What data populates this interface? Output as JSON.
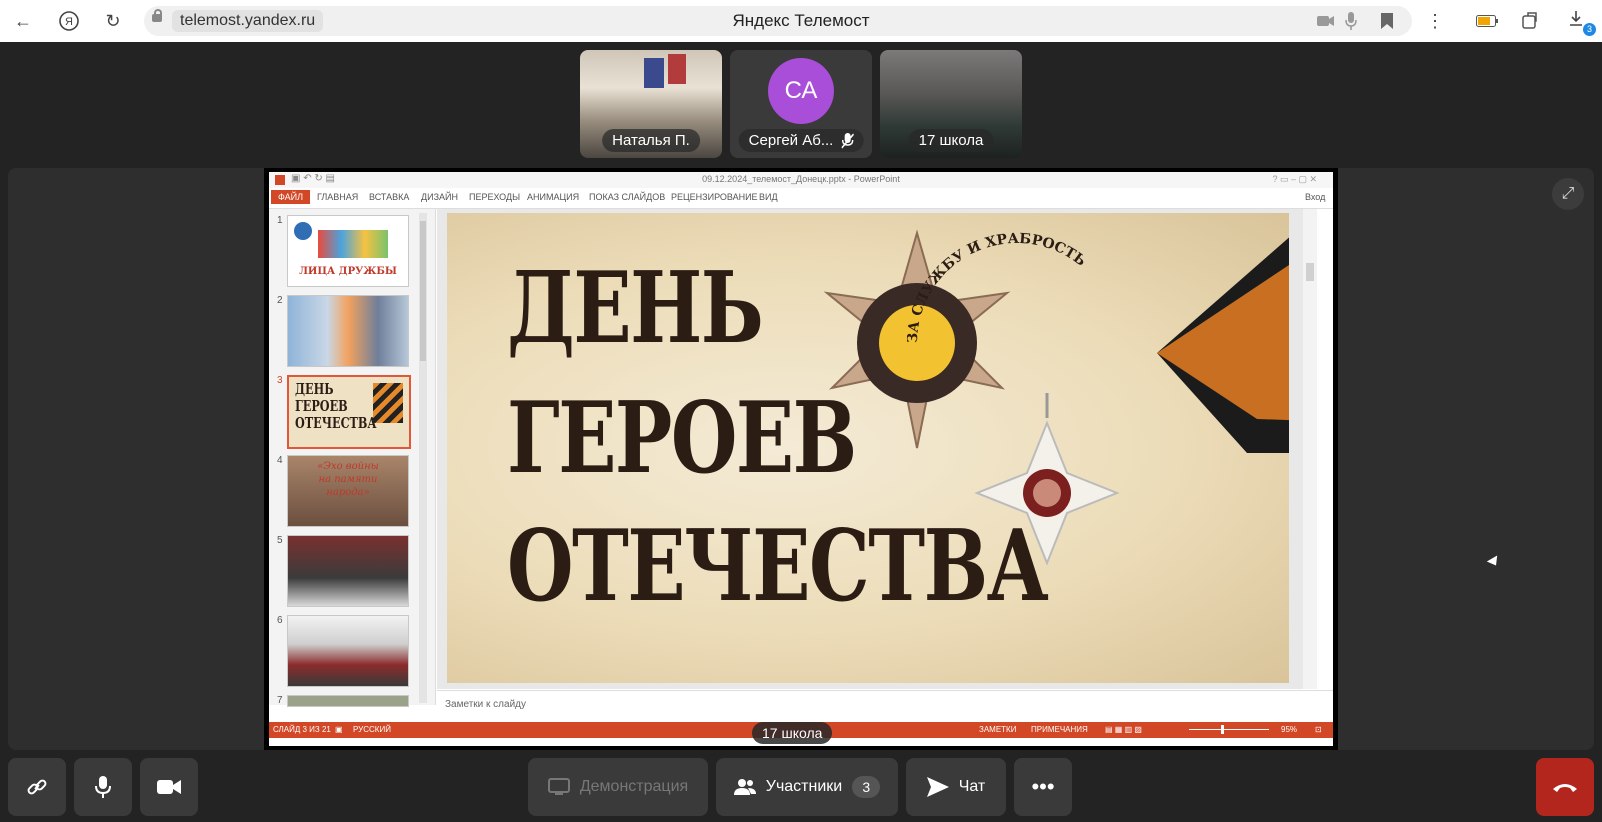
{
  "browser": {
    "url": "telemost.yandex.ru",
    "page_title": "Яндекс Телемост",
    "downloads_badge": "3"
  },
  "participants": [
    {
      "name": "Наталья П.",
      "kind": "video"
    },
    {
      "name": "Сергей Аб...",
      "initials": "СА",
      "muted": true,
      "kind": "avatar"
    },
    {
      "name": "17 школа",
      "kind": "video"
    }
  ],
  "screen_share": {
    "sharer_label": "17 школа",
    "app": {
      "window_title": "09.12.2024_телемост_Донецк.pptx - PowerPoint",
      "login": "Вход",
      "ribbon_tabs": [
        "ФАЙЛ",
        "ГЛАВНАЯ",
        "ВСТАВКА",
        "ДИЗАЙН",
        "ПЕРЕХОДЫ",
        "АНИМАЦИЯ",
        "ПОКАЗ СЛАЙДОВ",
        "РЕЦЕНЗИРОВАНИЕ",
        "ВИД"
      ],
      "thumbnails": [
        "1",
        "2",
        "3",
        "4",
        "5",
        "6",
        "7"
      ],
      "thumbnail_texts": {
        "t1": "ЛИЦА ДРУЖБЫ",
        "t3": [
          "ДЕНЬ",
          "ГЕРОЕВ",
          "ОТЕЧЕСТВА"
        ],
        "t4": [
          "«Эхо войны",
          "на памяти",
          "народа»"
        ]
      },
      "selected_slide": 3,
      "slide_headline": [
        "ДЕНЬ",
        "ГЕРОЕВ",
        "ОТЕЧЕСТВА"
      ],
      "medal_inscriptions": {
        "medal": "ЗА СЛУЖБУ И ХРАБРОСТЬ"
      },
      "notes_placeholder": "Заметки к слайду",
      "status": {
        "slide_info": "СЛАЙД 3 ИЗ 21",
        "language": "РУССКИЙ",
        "notes": "ЗАМЕТКИ",
        "comments": "ПРИМЕЧАНИЯ",
        "zoom": "95%"
      }
    }
  },
  "toolbar": {
    "demo_label": "Демонстрация",
    "participants_label": "Участники",
    "participants_count": "3",
    "chat_label": "Чат"
  },
  "colors": {
    "background": "#232323",
    "tile": "#3a3a3a",
    "avatar": "#a84ed8",
    "hangup": "#b3261e",
    "ppt_accent": "#d24726"
  }
}
